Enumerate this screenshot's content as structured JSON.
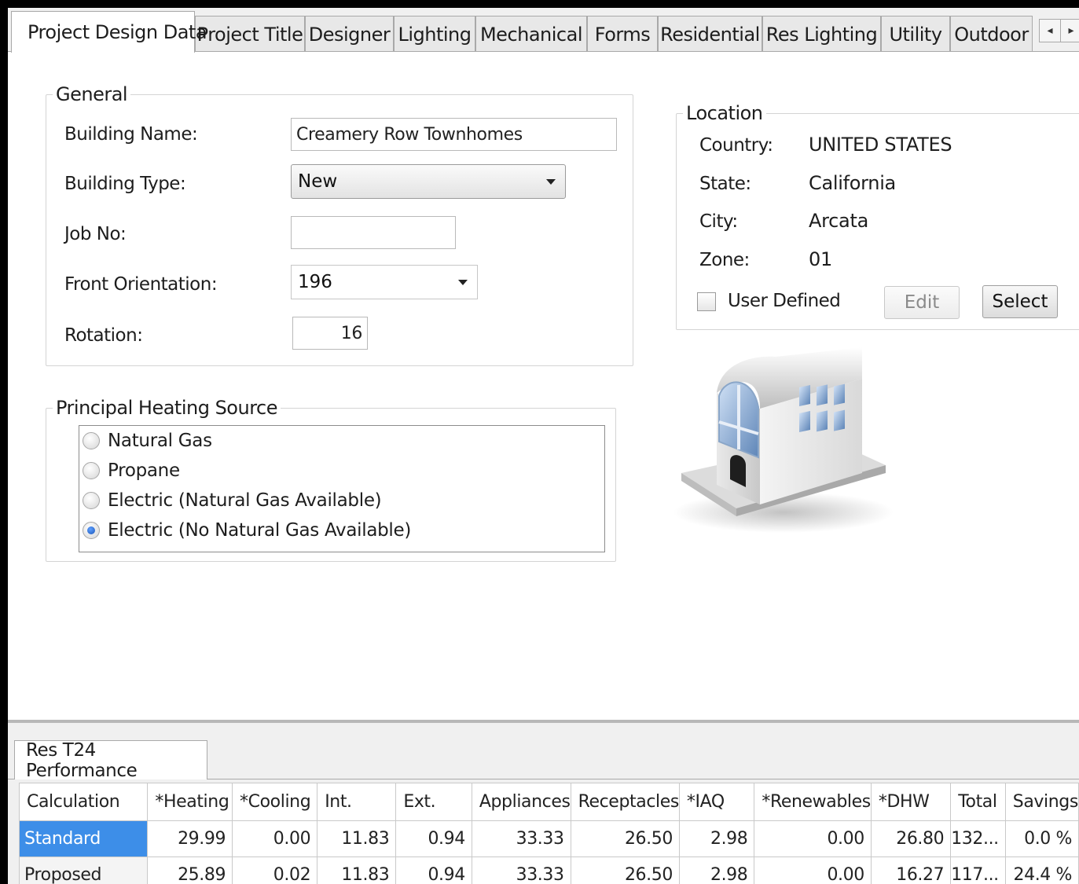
{
  "tabs": [
    {
      "label": "Project Design Data",
      "active": true
    },
    {
      "label": "Project Title"
    },
    {
      "label": "Designer"
    },
    {
      "label": "Lighting"
    },
    {
      "label": "Mechanical"
    },
    {
      "label": "Forms"
    },
    {
      "label": "Residential"
    },
    {
      "label": "Res Lighting"
    },
    {
      "label": "Utility"
    },
    {
      "label": "Outdoor"
    }
  ],
  "tab_scroll": {
    "left": "◂",
    "right": "▸"
  },
  "general": {
    "legend": "General",
    "building_name_label": "Building Name:",
    "building_name_value": "Creamery Row Townhomes",
    "building_type_label": "Building Type:",
    "building_type_value": "New",
    "job_no_label": "Job No:",
    "job_no_value": "",
    "front_orientation_label": "Front Orientation:",
    "front_orientation_value": "196",
    "rotation_label": "Rotation:",
    "rotation_value": "16"
  },
  "heating": {
    "legend": "Principal Heating Source",
    "options": [
      {
        "label": "Natural Gas",
        "selected": false
      },
      {
        "label": "Propane",
        "selected": false
      },
      {
        "label": "Electric (Natural Gas Available)",
        "selected": false
      },
      {
        "label": "Electric (No Natural Gas Available)",
        "selected": true
      }
    ]
  },
  "location": {
    "legend": "Location",
    "country_label": "Country:",
    "country_value": "UNITED STATES",
    "state_label": "State:",
    "state_value": "California",
    "city_label": "City:",
    "city_value": "Arcata",
    "zone_label": "Zone:",
    "zone_value": "01",
    "user_defined_label": "User Defined",
    "edit_label": "Edit",
    "select_label": "Select"
  },
  "performance": {
    "tab_label": "Res T24 Performance",
    "columns": [
      "Calculation",
      "*Heating",
      "*Cooling",
      "Int.",
      "Ext.",
      "Appliances",
      "Receptacles",
      "*IAQ",
      "*Renewables",
      "*DHW",
      "Total",
      "Savings"
    ],
    "rows": [
      {
        "name": "Standard",
        "selected": true,
        "values": [
          "29.99",
          "0.00",
          "11.83",
          "0.94",
          "33.33",
          "26.50",
          "2.98",
          "0.00",
          "26.80",
          "132...",
          "0.0 %"
        ]
      },
      {
        "name": "Proposed",
        "selected": false,
        "values": [
          "25.89",
          "0.02",
          "11.83",
          "0.94",
          "33.33",
          "26.50",
          "2.98",
          "0.00",
          "16.27",
          "117...",
          "24.4 %"
        ]
      }
    ]
  },
  "colors": {
    "selection": "#3d8ee8",
    "window_bg": "#f0f0f0"
  }
}
